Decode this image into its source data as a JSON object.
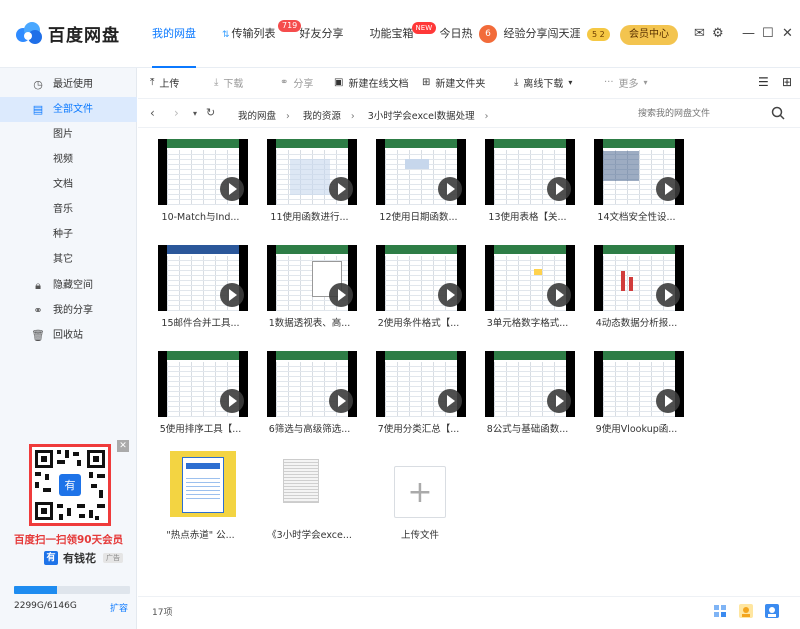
{
  "app": {
    "name": "百度网盘"
  },
  "topnav": [
    {
      "label": "我的网盘",
      "active": true
    },
    {
      "label": "传输列表",
      "badge": "719"
    },
    {
      "label": "好友分享"
    },
    {
      "label": "功能宝箱",
      "badge": "NEW"
    },
    {
      "label": "今日热",
      "extra": "经验分享闯天涯",
      "share_badge": "5 2"
    }
  ],
  "vip_button": "会员中心",
  "sidebar": {
    "items": [
      {
        "label": "最近使用",
        "icon": "clock-icon"
      },
      {
        "label": "全部文件",
        "icon": "file-icon",
        "active": true
      },
      {
        "label": "图片"
      },
      {
        "label": "视频"
      },
      {
        "label": "文档"
      },
      {
        "label": "音乐"
      },
      {
        "label": "种子"
      },
      {
        "label": "其它"
      },
      {
        "label": "隐藏空间",
        "icon": "lock-icon"
      },
      {
        "label": "我的分享",
        "icon": "share-icon"
      },
      {
        "label": "回收站",
        "icon": "trash-icon"
      }
    ],
    "promo": {
      "caption": "百度扫一扫领90天会员",
      "brand": "有钱花",
      "ad": "广告",
      "qr_icon_text": "有"
    },
    "storage": {
      "used": "2299G",
      "total": "6146G",
      "text": "2299G/6146G",
      "ratio": 0.374,
      "expand": "扩容"
    }
  },
  "toolbar": [
    {
      "label": "上传",
      "icon": "upload-icon",
      "disabled": false
    },
    {
      "label": "下载",
      "icon": "download-icon",
      "disabled": true
    },
    {
      "label": "分享",
      "icon": "share-icon",
      "disabled": true
    },
    {
      "label": "新建在线文档",
      "icon": "doc-icon",
      "disabled": false
    },
    {
      "label": "新建文件夹",
      "icon": "folder-icon",
      "disabled": false
    },
    {
      "label": "离线下载",
      "icon": "offline-download-icon",
      "disabled": false
    },
    {
      "label": "更多",
      "icon": "more-icon",
      "disabled": true
    }
  ],
  "breadcrumb": [
    "我的网盘",
    "我的资源",
    "3小时学会excel数据处理"
  ],
  "search": {
    "placeholder": "搜索我的网盘文件"
  },
  "files": [
    {
      "name": "10-Match与Ind...",
      "type": "video"
    },
    {
      "name": "11使用函数进行...",
      "type": "video"
    },
    {
      "name": "12使用日期函数...",
      "type": "video"
    },
    {
      "name": "13使用表格【关...",
      "type": "video"
    },
    {
      "name": "14文档安全性设...",
      "type": "video"
    },
    {
      "name": "15邮件合并工具...",
      "type": "video"
    },
    {
      "name": "1数据透视表、高...",
      "type": "video"
    },
    {
      "name": "2使用条件格式【...",
      "type": "video"
    },
    {
      "name": "3单元格数字格式...",
      "type": "video"
    },
    {
      "name": "4动态数据分析报...",
      "type": "video"
    },
    {
      "name": "5使用排序工具【...",
      "type": "video"
    },
    {
      "name": "6筛选与高级筛选...",
      "type": "video"
    },
    {
      "name": "7使用分类汇总【...",
      "type": "video"
    },
    {
      "name": "8公式与基础函数...",
      "type": "video"
    },
    {
      "name": "9使用Vlookup函...",
      "type": "video"
    },
    {
      "name": "\"热点赤道\" 公...",
      "type": "image"
    },
    {
      "name": "《3小时学会exce...",
      "type": "doc"
    }
  ],
  "upload_tile": {
    "label": "上传文件",
    "icon": "+"
  },
  "status": {
    "count": "17项"
  }
}
